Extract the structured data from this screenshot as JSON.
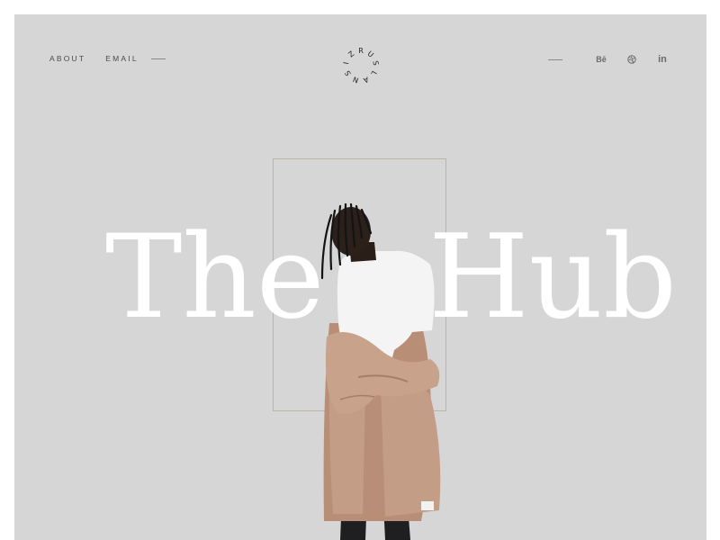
{
  "nav": {
    "about": "ABOUT",
    "email": "EMAIL"
  },
  "logo": {
    "text": "RUSLANSIZ"
  },
  "social": [
    {
      "label": "Bē",
      "icon": "behance-icon"
    },
    {
      "label": "",
      "icon": "dribbble-icon"
    },
    {
      "label": "in",
      "icon": "linkedin-icon"
    }
  ],
  "hero": {
    "word1": "The",
    "word2": "Hub"
  },
  "colors": {
    "background": "#d6d6d6",
    "headline": "#ffffff",
    "frame": "#bfb3a6",
    "coat": "#c39d86",
    "text": "#4a4a4a"
  }
}
